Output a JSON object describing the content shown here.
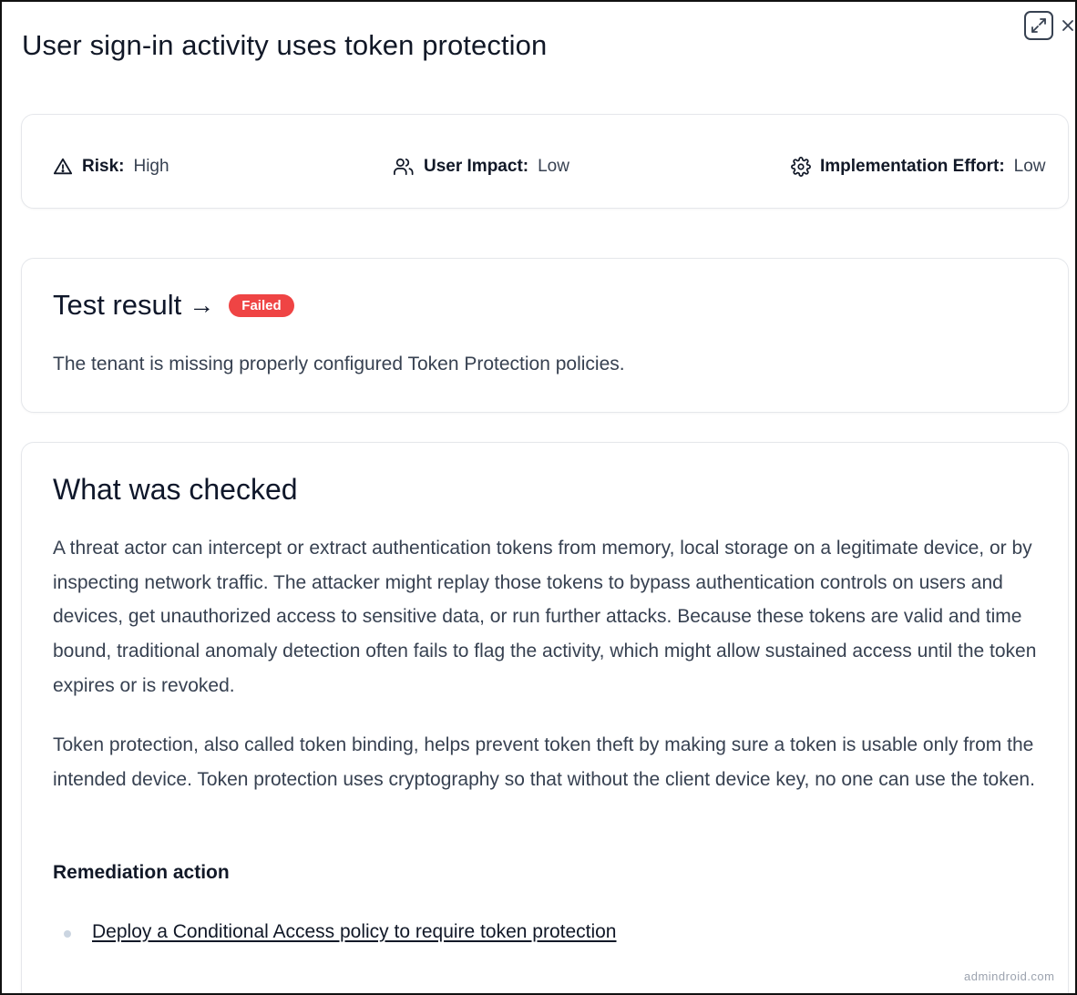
{
  "panel": {
    "title": "User sign-in activity uses token protection",
    "expand_icon": "expand-diagonal-icon",
    "close_icon": "close-icon"
  },
  "meta": {
    "risk_label": "Risk:",
    "risk_value": "High",
    "risk_icon": "warning-triangle-icon",
    "impact_label": "User Impact:",
    "impact_value": "Low",
    "impact_icon": "users-icon",
    "effort_label": "Implementation Effort:",
    "effort_value": "Low",
    "effort_icon": "gear-icon"
  },
  "result": {
    "heading": "Test result",
    "arrow": "→",
    "status": "Failed",
    "status_color": "#ef4444",
    "message": "The tenant is missing properly configured Token Protection policies."
  },
  "checked": {
    "heading": "What was checked",
    "paragraph1": "A threat actor can intercept or extract authentication tokens from memory, local storage on a legitimate device, or by inspecting network traffic. The attacker might replay those tokens to bypass authentication controls on users and devices, get unauthorized access to sensitive data, or run further attacks. Because these tokens are valid and time bound, traditional anomaly detection often fails to flag the activity, which might allow sustained access until the token expires or is revoked.",
    "paragraph2": "Token protection, also called token binding, helps prevent token theft by making sure a token is usable only from the intended device. Token protection uses cryptography so that without the client device key, no one can use the token.",
    "remediation_heading": "Remediation action",
    "remediation_links": [
      "Deploy a Conditional Access policy to require token protection"
    ]
  },
  "watermark": "admindroid.com"
}
